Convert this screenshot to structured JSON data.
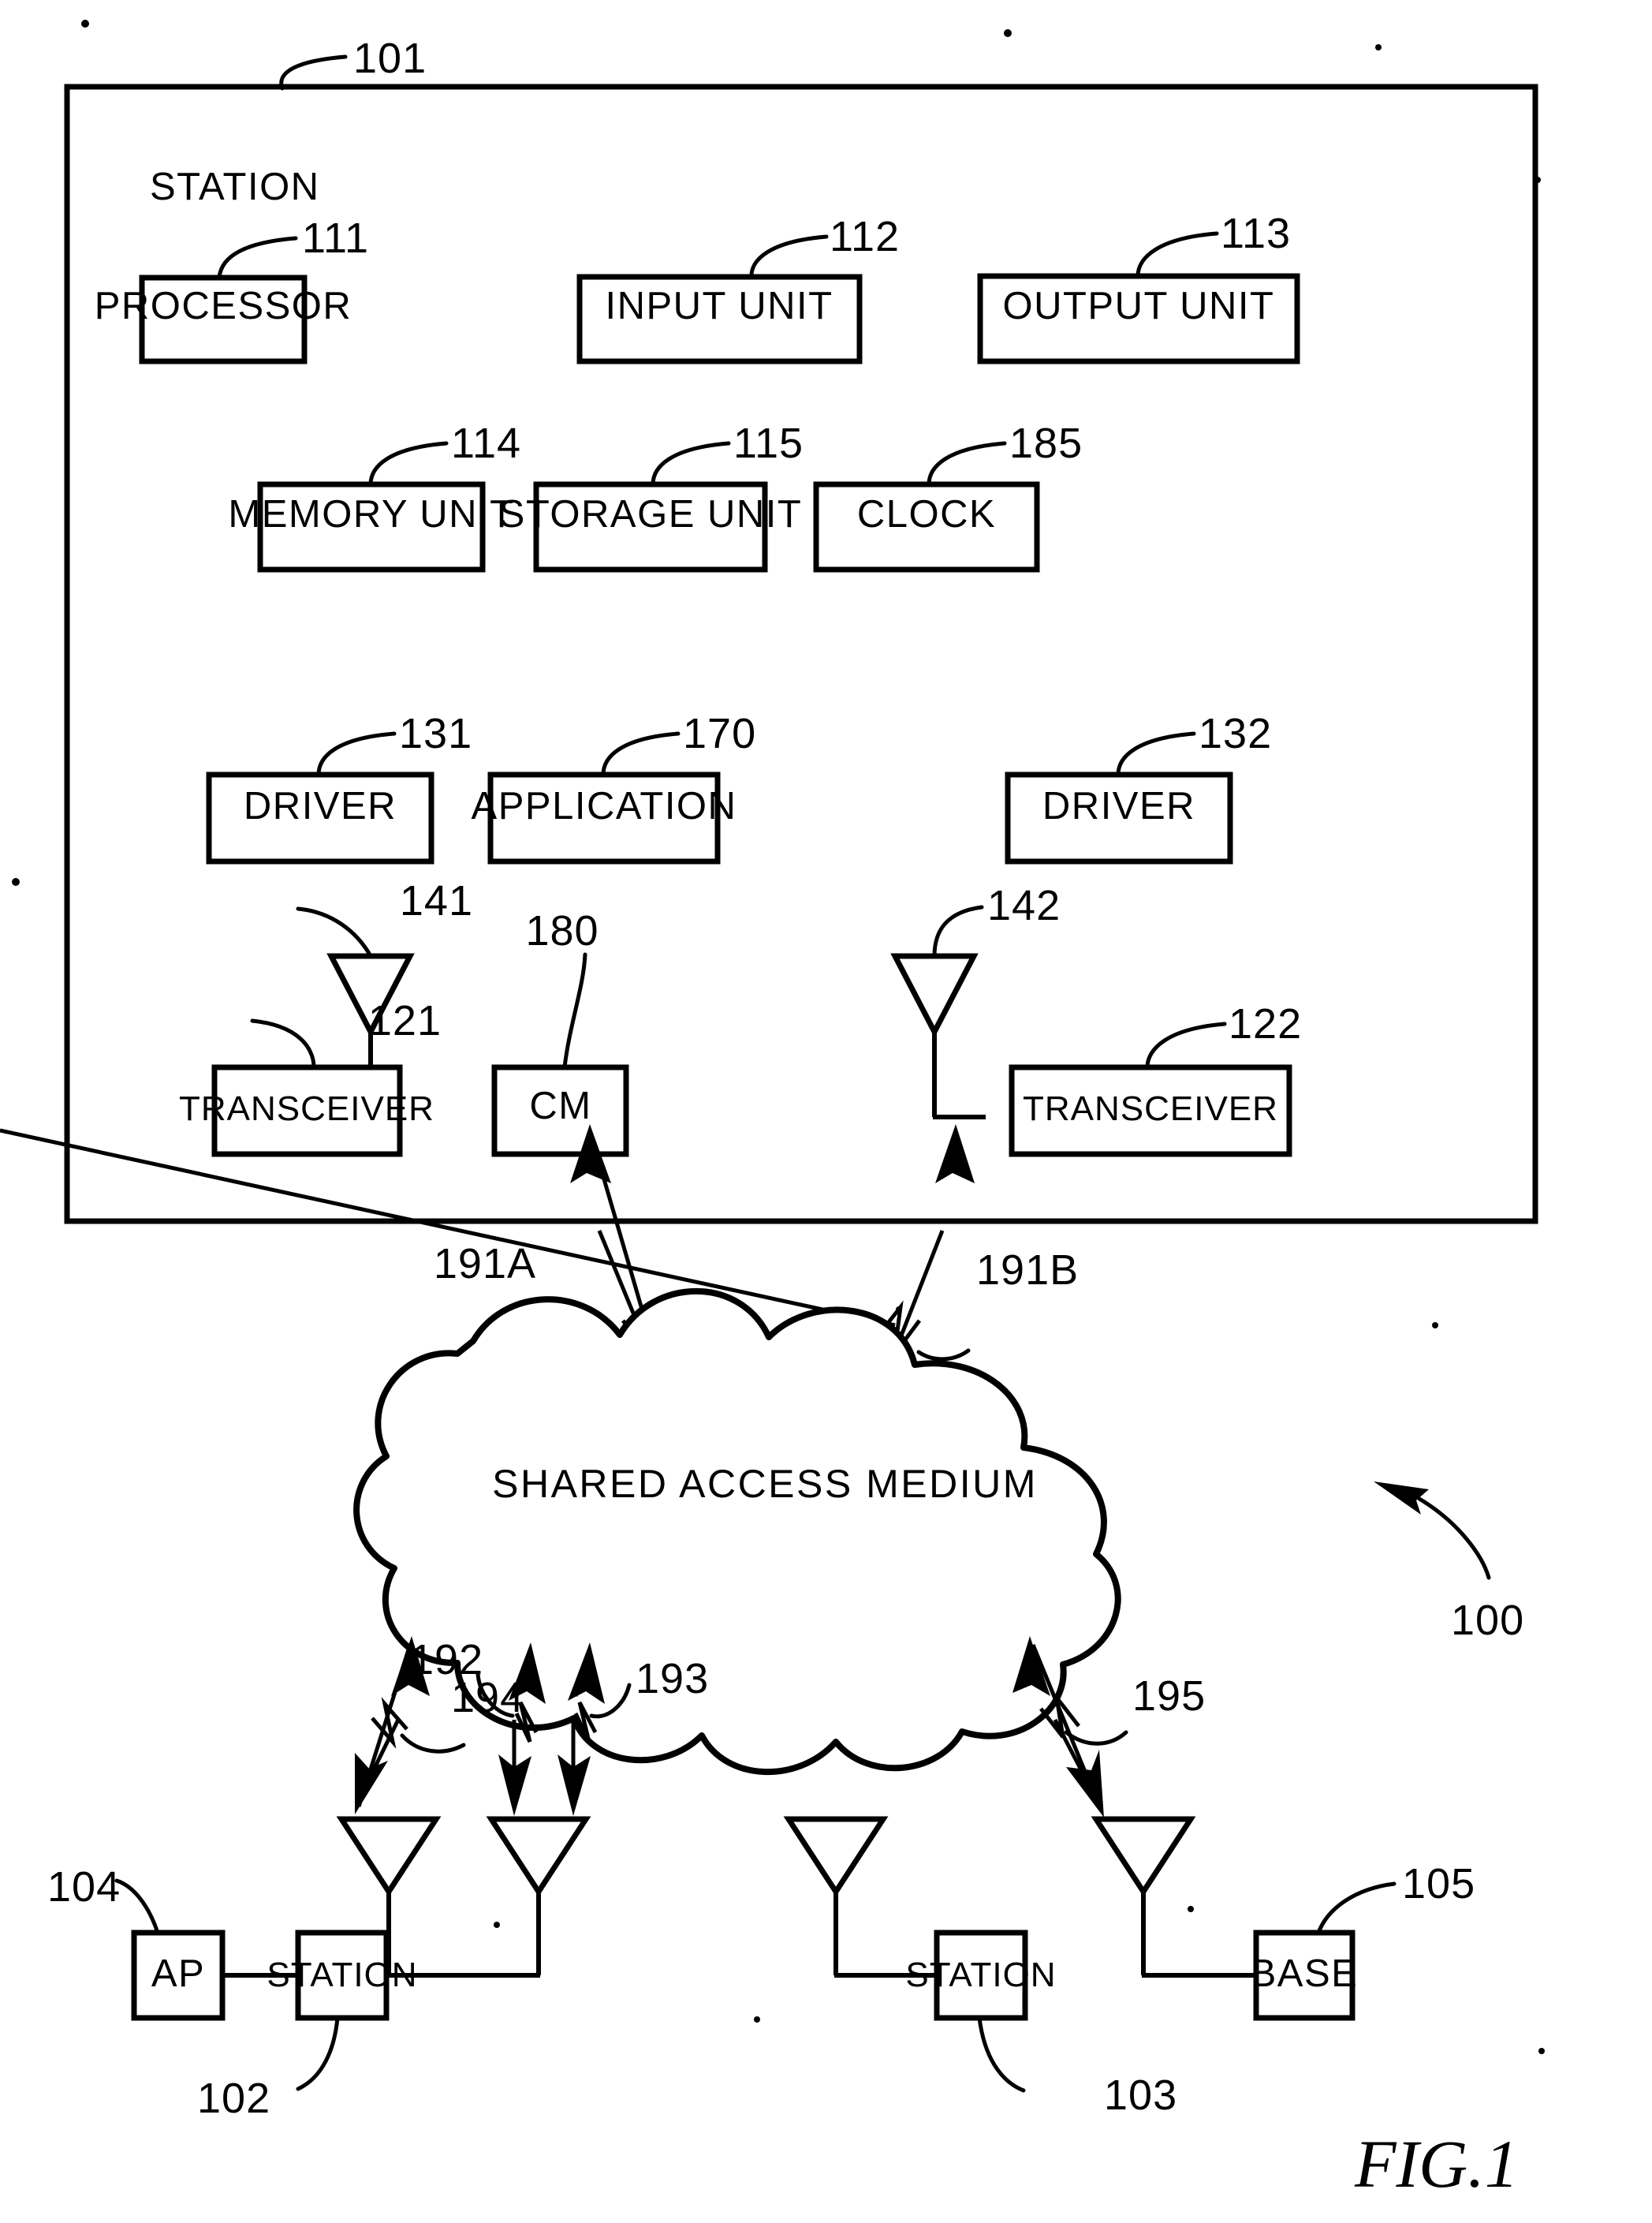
{
  "figure": {
    "label": "FIG.1",
    "system_ref": "100"
  },
  "station": {
    "title": "STATION",
    "ref": "101",
    "components": [
      {
        "label": "PROCESSOR",
        "ref": "111"
      },
      {
        "label": "INPUT  UNIT",
        "ref": "112"
      },
      {
        "label": "OUTPUT  UNIT",
        "ref": "113"
      },
      {
        "label": "MEMORY  UNIT",
        "ref": "114"
      },
      {
        "label": "STORAGE  UNIT",
        "ref": "115"
      },
      {
        "label": "CLOCK",
        "ref": "185"
      },
      {
        "label": "DRIVER",
        "ref": "131"
      },
      {
        "label": "APPLICATION",
        "ref": "170"
      },
      {
        "label": "DRIVER",
        "ref": "132"
      },
      {
        "label": "TRANSCEIVER",
        "ref": "121"
      },
      {
        "label": "CM",
        "ref": "180"
      },
      {
        "label": "TRANSCEIVER",
        "ref": "122"
      }
    ],
    "antennas": [
      {
        "ref": "141"
      },
      {
        "ref": "142"
      }
    ]
  },
  "links": {
    "station_to_medium": [
      {
        "ref": "191A"
      },
      {
        "ref": "191B"
      }
    ],
    "medium_to_nodes": [
      {
        "ref": "194"
      },
      {
        "ref": "192"
      },
      {
        "ref": "193"
      },
      {
        "ref": "195"
      }
    ]
  },
  "medium": {
    "label": "SHARED  ACCESS  MEDIUM"
  },
  "nodes": [
    {
      "label": "AP",
      "ref": "104"
    },
    {
      "label": "STATION",
      "ref": "102"
    },
    {
      "label": "STATION",
      "ref": "103"
    },
    {
      "label": "BASE",
      "ref": "105"
    }
  ],
  "colors": {
    "ink": "#000000",
    "paper": "#ffffff"
  }
}
